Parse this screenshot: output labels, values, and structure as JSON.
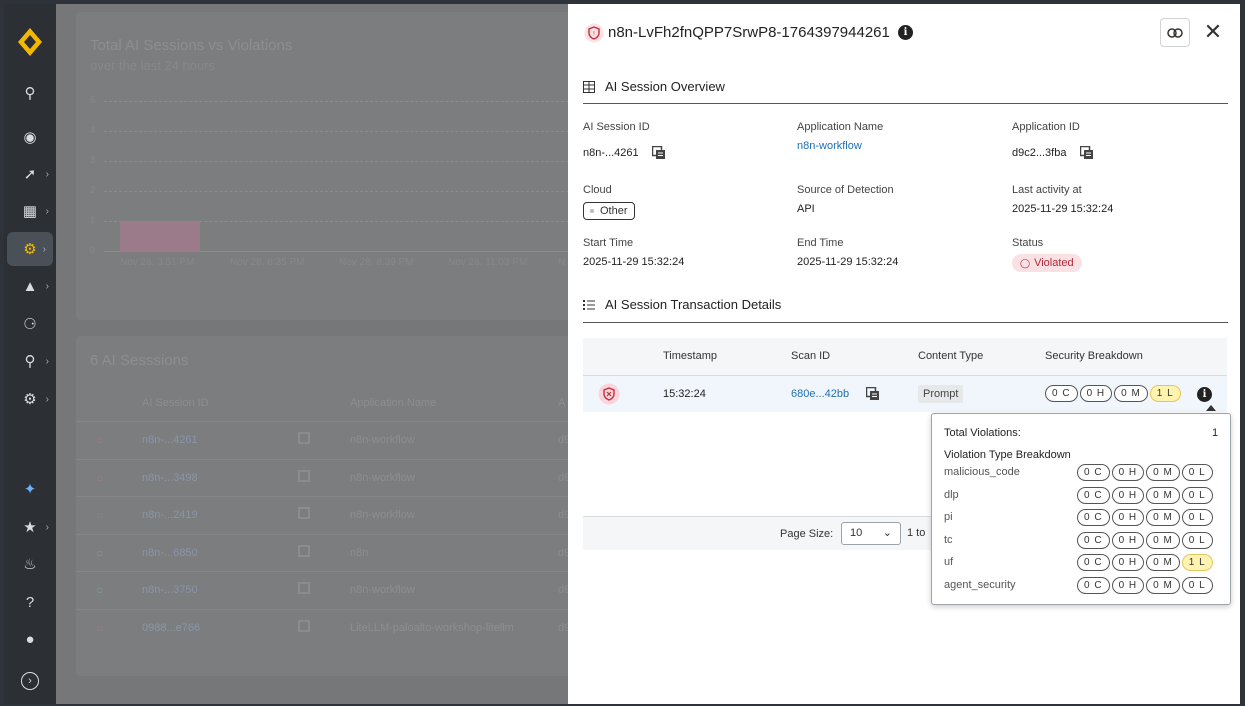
{
  "background": {
    "chart": {
      "title": "Total AI Sessions vs Violations",
      "subtitle": "over the last 24 hours",
      "y_ticks": [
        "5",
        "4",
        "3",
        "2",
        "1",
        "0"
      ],
      "x_ticks": [
        "Nov 28, 3:51 PM",
        "Nov 28, 6:35 PM",
        "Nov 28, 8:39 PM",
        "Nov 28, 11:03 PM",
        "N"
      ]
    },
    "sessions": {
      "title": "6 AI Sesssions",
      "columns": [
        "AI Session ID",
        "Application Name",
        "A"
      ],
      "rows": [
        {
          "id": "n8n-...4261",
          "app": "n8n-workflow",
          "suffix": "d9",
          "status": "violated"
        },
        {
          "id": "n8n-...3498",
          "app": "n8n-workflow",
          "suffix": "d9",
          "status": "violated"
        },
        {
          "id": "n8n-...2419",
          "app": "n8n-workflow",
          "suffix": "d9",
          "status": "violated"
        },
        {
          "id": "n8n-...6850",
          "app": "n8n",
          "suffix": "d9",
          "status": "ok"
        },
        {
          "id": "n8n-...3750",
          "app": "n8n-workflow",
          "suffix": "d9",
          "status": "ok"
        },
        {
          "id": "0988...e766",
          "app": "LiteLLM-paloalto-workshop-litellm",
          "suffix": "d9",
          "status": "violated"
        }
      ]
    }
  },
  "panel": {
    "title": "n8n-LvFh2fnQPP7SrwP8-1764397944261",
    "overview": {
      "heading": "AI Session Overview",
      "fields": {
        "session_id_label": "AI Session ID",
        "session_id": "n8n-...4261",
        "app_name_label": "Application Name",
        "app_name": "n8n-workflow",
        "app_id_label": "Application ID",
        "app_id": "d9c2...3fba",
        "cloud_label": "Cloud",
        "cloud": "Other",
        "source_label": "Source of Detection",
        "source": "API",
        "last_activity_label": "Last activity at",
        "last_activity": "2025-11-29 15:32:24",
        "start_label": "Start Time",
        "start": "2025-11-29 15:32:24",
        "end_label": "End Time",
        "end": "2025-11-29 15:32:24",
        "status_label": "Status",
        "status": "Violated"
      }
    },
    "transactions": {
      "heading": "AI Session Transaction Details",
      "columns": [
        "Timestamp",
        "Scan ID",
        "Content Type",
        "Security Breakdown"
      ],
      "row": {
        "timestamp": "15:32:24",
        "scan_id": "680e...42bb",
        "content_type": "Prompt",
        "breakdown": [
          "0 C",
          "0 H",
          "0 M",
          "1 L"
        ]
      },
      "footer": {
        "page_size_label": "Page Size:",
        "page_size": "10",
        "range": "1 to"
      }
    },
    "tooltip": {
      "total_label": "Total Violations:",
      "total": "1",
      "breakdown_label": "Violation Type Breakdown",
      "types": [
        {
          "name": "malicious_code",
          "pills": [
            "0 C",
            "0 H",
            "0 M",
            "0 L"
          ]
        },
        {
          "name": "dlp",
          "pills": [
            "0 C",
            "0 H",
            "0 M",
            "0 L"
          ]
        },
        {
          "name": "pi",
          "pills": [
            "0 C",
            "0 H",
            "0 M",
            "0 L"
          ]
        },
        {
          "name": "tc",
          "pills": [
            "0 C",
            "0 H",
            "0 M",
            "0 L"
          ]
        },
        {
          "name": "uf",
          "pills": [
            "0 C",
            "0 H",
            "0 M",
            "1 L"
          ]
        },
        {
          "name": "agent_security",
          "pills": [
            "0 C",
            "0 H",
            "0 M",
            "0 L"
          ]
        }
      ]
    }
  },
  "colors": {
    "accent": "#1f6fb3",
    "violated": "#b02a3b",
    "highlight": "#fff3b0",
    "brand": "#f5b800"
  }
}
